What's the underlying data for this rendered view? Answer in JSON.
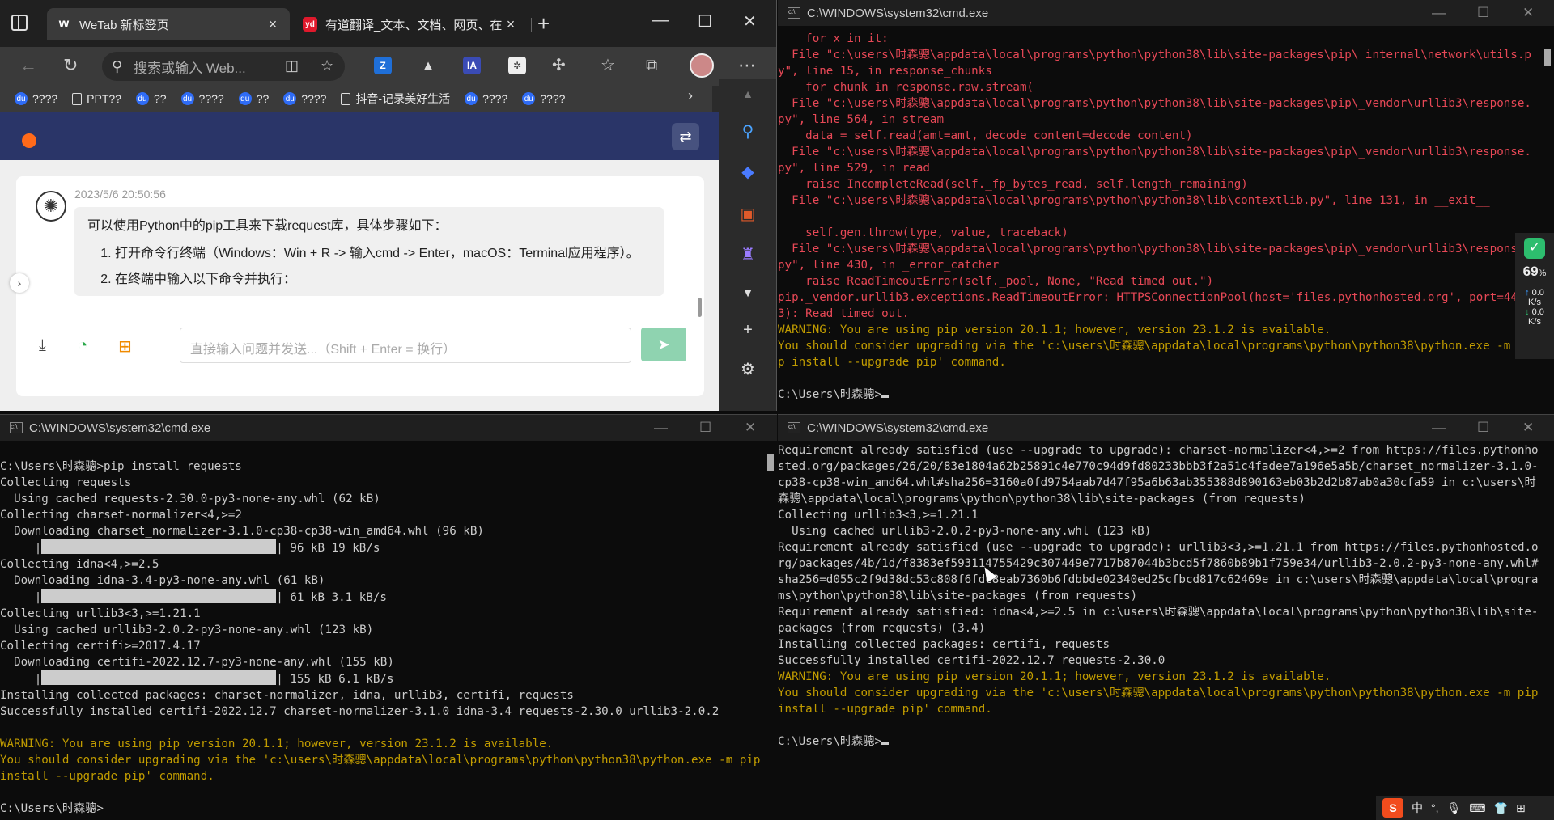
{
  "browser": {
    "tabs": [
      {
        "title": "WeTab 新标签页",
        "favicon": "wetab-icon",
        "active": true
      },
      {
        "title": "有道翻译_文本、文档、网页、在",
        "favicon": "youdao-icon",
        "active": false
      }
    ],
    "omnibox_placeholder": "搜索或输入 Web...",
    "ext_labels": {
      "ia": "IA"
    },
    "youdao_label": "yd",
    "bookmarks": [
      {
        "label": "????",
        "icon": "baidu-paw-icon"
      },
      {
        "label": "PPT??",
        "icon": "doc-icon"
      },
      {
        "label": "??",
        "icon": "baidu-paw-icon"
      },
      {
        "label": "????",
        "icon": "baidu-paw-icon"
      },
      {
        "label": "??",
        "icon": "baidu-paw-icon"
      },
      {
        "label": "????",
        "icon": "baidu-paw-icon"
      },
      {
        "label": "抖音-记录美好生活",
        "icon": "doc-icon"
      },
      {
        "label": "????",
        "icon": "baidu-paw-icon"
      },
      {
        "label": "????",
        "icon": "baidu-paw-icon"
      }
    ],
    "chat": {
      "timestamp": "2023/5/6 20:50:56",
      "intro": "可以使用Python中的pip工具来下载request库，具体步骤如下：",
      "step1": "打开命令行终端（Windows：Win + R -> 输入cmd -> Enter，macOS：Terminal应用程序）。",
      "step2": "在终端中输入以下命令并执行："
    },
    "input_placeholder": "直接输入问题并发送...（Shift + Enter = 换行）"
  },
  "console_title": "C:\\WINDOWS\\system32\\cmd.exe",
  "console_top_right": [
    {
      "c": "red",
      "t": "    for x in it:"
    },
    {
      "c": "red",
      "t": "  File \"c:\\users\\时森骢\\appdata\\local\\programs\\python\\python38\\lib\\site-packages\\pip\\_internal\\network\\utils.py\", line 15, in response_chunks"
    },
    {
      "c": "red",
      "t": "    for chunk in response.raw.stream("
    },
    {
      "c": "red",
      "t": "  File \"c:\\users\\时森骢\\appdata\\local\\programs\\python\\python38\\lib\\site-packages\\pip\\_vendor\\urllib3\\response.py\", line 564, in stream"
    },
    {
      "c": "red",
      "t": "    data = self.read(amt=amt, decode_content=decode_content)"
    },
    {
      "c": "red",
      "t": "  File \"c:\\users\\时森骢\\appdata\\local\\programs\\python\\python38\\lib\\site-packages\\pip\\_vendor\\urllib3\\response.py\", line 529, in read"
    },
    {
      "c": "red",
      "t": "    raise IncompleteRead(self._fp_bytes_read, self.length_remaining)"
    },
    {
      "c": "red",
      "t": "  File \"c:\\users\\时森骢\\appdata\\local\\programs\\python\\python38\\lib\\contextlib.py\", line 131, in __exit__"
    },
    {
      "c": "red",
      "t": ""
    },
    {
      "c": "red",
      "t": "    self.gen.throw(type, value, traceback)"
    },
    {
      "c": "red",
      "t": "  File \"c:\\users\\时森骢\\appdata\\local\\programs\\python\\python38\\lib\\site-packages\\pip\\_vendor\\urllib3\\response.py\", line 430, in _error_catcher"
    },
    {
      "c": "red",
      "t": "    raise ReadTimeoutError(self._pool, None, \"Read timed out.\")"
    },
    {
      "c": "red",
      "t": "pip._vendor.urllib3.exceptions.ReadTimeoutError: HTTPSConnectionPool(host='files.pythonhosted.org', port=443): Read timed out."
    },
    {
      "c": "yellow",
      "t": "WARNING: You are using pip version 20.1.1; however, version 23.1.2 is available."
    },
    {
      "c": "yellow",
      "t": "You should consider upgrading via the 'c:\\users\\时森骢\\appdata\\local\\programs\\python\\python38\\python.exe -m pip install --upgrade pip' command."
    },
    {
      "c": "white",
      "t": ""
    },
    {
      "c": "white",
      "t": "C:\\Users\\时森骢>",
      "cursor": true
    }
  ],
  "console_bottom_left": [
    {
      "c": "white",
      "t": ""
    },
    {
      "c": "white",
      "t": "C:\\Users\\时森骢>pip install requests"
    },
    {
      "c": "white",
      "t": "Collecting requests"
    },
    {
      "c": "white",
      "t": "  Using cached requests-2.30.0-py3-none-any.whl (62 kB)"
    },
    {
      "c": "white",
      "t": "Collecting charset-normalizer<4,>=2"
    },
    {
      "c": "white",
      "t": "  Downloading charset_normalizer-3.1.0-cp38-cp38-win_amd64.whl (96 kB)"
    },
    {
      "c": "white",
      "t": "     |",
      "bar": true,
      "after": "| 96 kB 19 kB/s"
    },
    {
      "c": "white",
      "t": "Collecting idna<4,>=2.5"
    },
    {
      "c": "white",
      "t": "  Downloading idna-3.4-py3-none-any.whl (61 kB)"
    },
    {
      "c": "white",
      "t": "     |",
      "bar": true,
      "after": "| 61 kB 3.1 kB/s"
    },
    {
      "c": "white",
      "t": "Collecting urllib3<3,>=1.21.1"
    },
    {
      "c": "white",
      "t": "  Using cached urllib3-2.0.2-py3-none-any.whl (123 kB)"
    },
    {
      "c": "white",
      "t": "Collecting certifi>=2017.4.17"
    },
    {
      "c": "white",
      "t": "  Downloading certifi-2022.12.7-py3-none-any.whl (155 kB)"
    },
    {
      "c": "white",
      "t": "     |",
      "bar": true,
      "after": "| 155 kB 6.1 kB/s"
    },
    {
      "c": "white",
      "t": "Installing collected packages: charset-normalizer, idna, urllib3, certifi, requests"
    },
    {
      "c": "white",
      "t": "Successfully installed certifi-2022.12.7 charset-normalizer-3.1.0 idna-3.4 requests-2.30.0 urllib3-2.0.2"
    },
    {
      "c": "white",
      "t": ""
    },
    {
      "c": "yellow",
      "t": "WARNING: You are using pip version 20.1.1; however, version 23.1.2 is available."
    },
    {
      "c": "yellow",
      "t": "You should consider upgrading via the 'c:\\users\\时森骢\\appdata\\local\\programs\\python\\python38\\python.exe -m pip install --upgrade pip' command."
    },
    {
      "c": "white",
      "t": ""
    },
    {
      "c": "white",
      "t": "C:\\Users\\时森骢>"
    }
  ],
  "console_bottom_right": [
    {
      "c": "white",
      "t": "Requirement already satisfied (use --upgrade to upgrade): charset-normalizer<4,>=2 from https://files.pythonhosted.org/packages/26/20/83e1804a62b25891c4e770c94d9fd80233bbb3f2a51c4fadee7a196e5a5b/charset_normalizer-3.1.0-cp38-cp38-win_amd64.whl#sha256=3160a0fd9754aab7d47f95a6b63ab355388d890163eb03b2d2b87ab0a30cfa59 in c:\\users\\时森骢\\appdata\\local\\programs\\python\\python38\\lib\\site-packages (from requests)"
    },
    {
      "c": "white",
      "t": "Collecting urllib3<3,>=1.21.1"
    },
    {
      "c": "white",
      "t": "  Using cached urllib3-2.0.2-py3-none-any.whl (123 kB)"
    },
    {
      "c": "white",
      "t": "Requirement already satisfied (use --upgrade to upgrade): urllib3<3,>=1.21.1 from https://files.pythonhosted.org/packages/4b/1d/f8383ef593114755429c307449e7717b87044b3bcd5f7860b89b1f759e34/urllib3-2.0.2-py3-none-any.whl#sha256=d055c2f9d38dc53c808f6fdc8eab7360b6fdbbde02340ed25cfbcd817c62469e in c:\\users\\时森骢\\appdata\\local\\programs\\python\\python38\\lib\\site-packages (from requests)"
    },
    {
      "c": "white",
      "t": "Requirement already satisfied: idna<4,>=2.5 in c:\\users\\时森骢\\appdata\\local\\programs\\python\\python38\\lib\\site-packages (from requests) (3.4)"
    },
    {
      "c": "white",
      "t": "Installing collected packages: certifi, requests"
    },
    {
      "c": "white",
      "t": "Successfully installed certifi-2022.12.7 requests-2.30.0"
    },
    {
      "c": "yellow",
      "t": "WARNING: You are using pip version 20.1.1; however, version 23.1.2 is available."
    },
    {
      "c": "yellow",
      "t": "You should consider upgrading via the 'c:\\users\\时森骢\\appdata\\local\\programs\\python\\python38\\python.exe -m pip install --upgrade pip' command."
    },
    {
      "c": "white",
      "t": ""
    },
    {
      "c": "white",
      "t": "C:\\Users\\时森骢>",
      "cursor": true
    }
  ],
  "netmon": {
    "percent": "69",
    "unit": "%",
    "up": "0.0",
    "down": "0.0",
    "rate_unit": "K/s"
  },
  "tray": {
    "ime_label": "S",
    "ime_mode": "中",
    "punct": "°,"
  },
  "colors": {
    "accent_header": "#2a3568",
    "send_button": "#8fd3b0",
    "console_red": "#e74856",
    "console_yellow": "#c19c00"
  }
}
